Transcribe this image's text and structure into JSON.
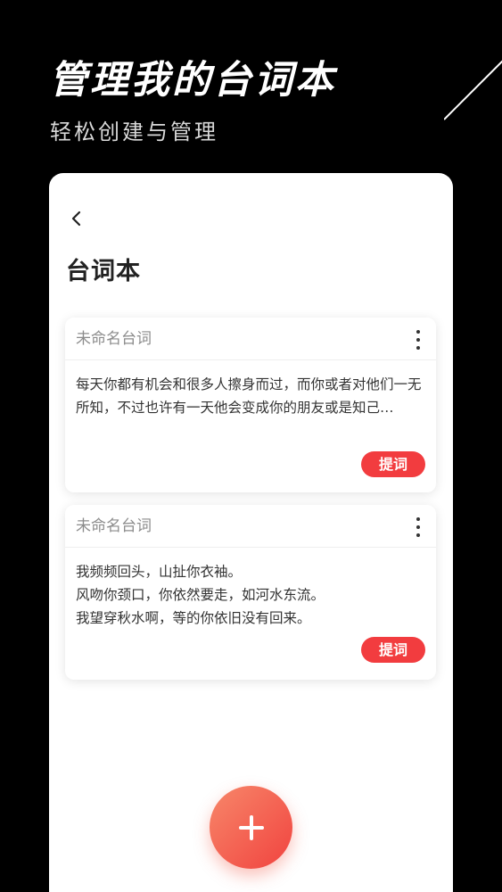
{
  "promo": {
    "title": "管理我的台词本",
    "subtitle": "轻松创建与管理"
  },
  "screen": {
    "title": "台词本",
    "back_icon": "chevron-left-icon",
    "add_icon": "plus-icon"
  },
  "scripts": [
    {
      "title": "未命名台词",
      "body": "每天你都有机会和很多人擦身而过，而你或者对他们一无所知，不过也许有一天他会变成你的朋友或是知己…",
      "action_label": "提词"
    },
    {
      "title": "未命名台词",
      "body": "我频频回头，山扯你衣袖。\n风吻你颈口，你依然要走，如河水东流。\n我望穿秋水啊，等的你依旧没有回来。",
      "action_label": "提词"
    }
  ],
  "colors": {
    "accent": "#f23c3f",
    "fab_gradient_start": "#f7876a",
    "fab_gradient_end": "#f1433f",
    "background": "#000000"
  }
}
